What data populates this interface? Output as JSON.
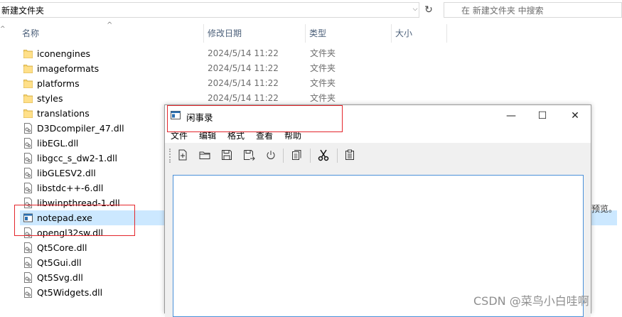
{
  "address": {
    "path": "新建文件夹"
  },
  "search": {
    "placeholder": "在 新建文件夹 中搜索"
  },
  "columns": {
    "name": "名称",
    "date": "修改日期",
    "type": "类型",
    "size": "大小"
  },
  "files": [
    {
      "name": "iconengines",
      "date": "2024/5/14 11:22",
      "type": "文件夹",
      "kind": "folder"
    },
    {
      "name": "imageformats",
      "date": "2024/5/14 11:22",
      "type": "文件夹",
      "kind": "folder"
    },
    {
      "name": "platforms",
      "date": "2024/5/14 11:22",
      "type": "文件夹",
      "kind": "folder"
    },
    {
      "name": "styles",
      "date": "2024/5/14 11:22",
      "type": "文件夹",
      "kind": "folder"
    },
    {
      "name": "translations",
      "date": "",
      "type": "",
      "kind": "folder"
    },
    {
      "name": "D3Dcompiler_47.dll",
      "date": "",
      "type": "",
      "kind": "dll"
    },
    {
      "name": "libEGL.dll",
      "date": "",
      "type": "",
      "kind": "dll"
    },
    {
      "name": "libgcc_s_dw2-1.dll",
      "date": "",
      "type": "",
      "kind": "dll"
    },
    {
      "name": "libGLESV2.dll",
      "date": "",
      "type": "",
      "kind": "dll"
    },
    {
      "name": "libstdc++-6.dll",
      "date": "",
      "type": "",
      "kind": "dll"
    },
    {
      "name": "libwinpthread-1.dll",
      "date": "",
      "type": "",
      "kind": "dll"
    },
    {
      "name": "notepad.exe",
      "date": "",
      "type": "",
      "kind": "exe"
    },
    {
      "name": "opengl32sw.dll",
      "date": "",
      "type": "",
      "kind": "dll"
    },
    {
      "name": "Qt5Core.dll",
      "date": "",
      "type": "",
      "kind": "dll"
    },
    {
      "name": "Qt5Gui.dll",
      "date": "",
      "type": "",
      "kind": "dll"
    },
    {
      "name": "Qt5Svg.dll",
      "date": "",
      "type": "",
      "kind": "dll"
    },
    {
      "name": "Qt5Widgets.dll",
      "date": "",
      "type": "",
      "kind": "dll"
    }
  ],
  "preview_text": "预览。",
  "watermark": "CSDN @菜鸟小白哇啊",
  "notepad": {
    "title": "闲事录",
    "menus": [
      "文件",
      "编辑",
      "格式",
      "查看",
      "帮助"
    ],
    "toolbar": [
      "new-file-icon",
      "open-folder-icon",
      "save-icon",
      "save-as-icon",
      "power-icon",
      "copy-icon",
      "cut-icon",
      "paste-icon"
    ]
  },
  "colors": {
    "selection": "#cce8ff",
    "highlight": "#e4262c",
    "editor_border": "#4a90d9"
  }
}
